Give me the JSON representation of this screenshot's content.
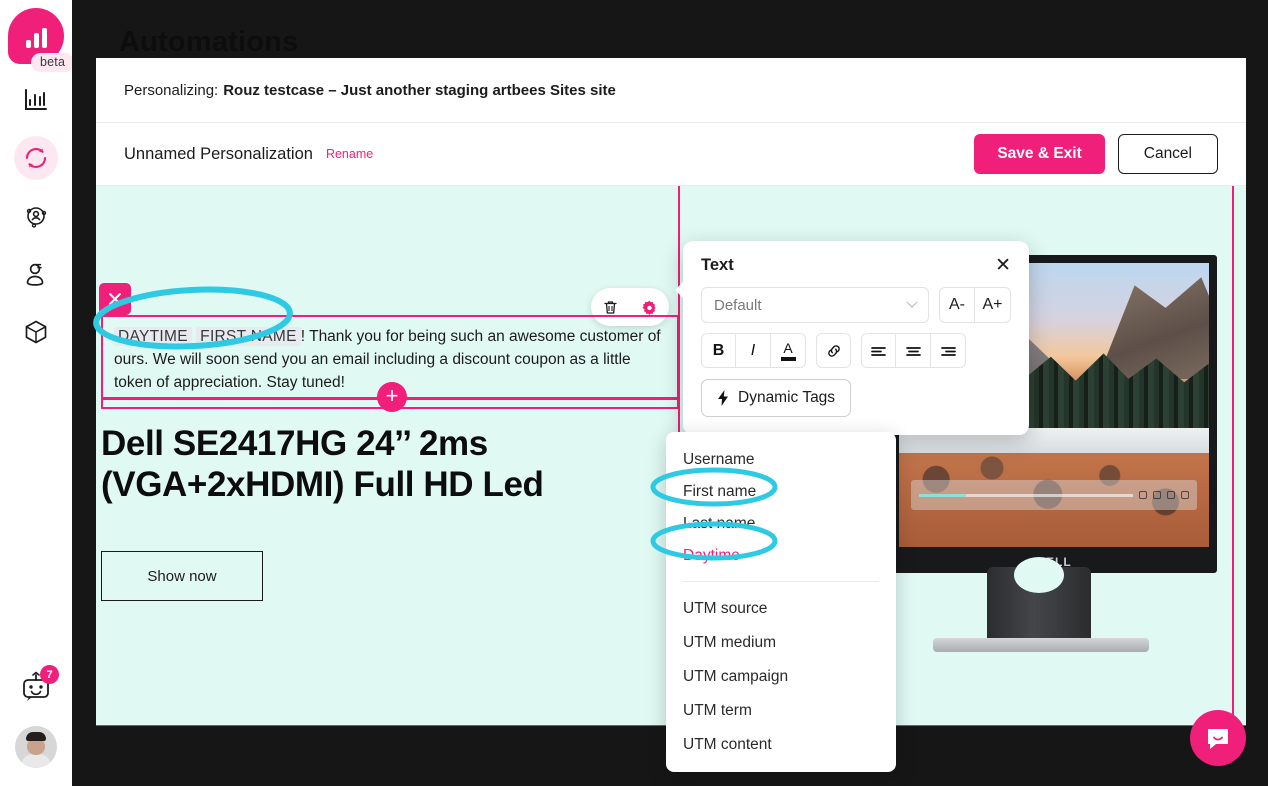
{
  "sidebar": {
    "logo_name": "artbees-logo",
    "beta_label": "beta",
    "items": [
      {
        "icon": "bar-chart-icon",
        "name": "analytics"
      },
      {
        "icon": "refresh-cycle-icon",
        "name": "automations"
      },
      {
        "icon": "audience-network-icon",
        "name": "audience"
      },
      {
        "icon": "visitor-icon",
        "name": "visitors"
      },
      {
        "icon": "package-cube-icon",
        "name": "products"
      }
    ],
    "bot_icon": "chat-bot-icon",
    "bot_badge": "7",
    "avatar_name": "user-avatar"
  },
  "page": {
    "title": "Automations"
  },
  "modal": {
    "header_prefix": "Personalizing:",
    "header_site": "Rouz testcase – Just another staging artbees Sites site",
    "personalization_name": "Unnamed Personalization",
    "rename_label": "Rename",
    "save_label": "Save & Exit",
    "cancel_label": "Cancel"
  },
  "canvas": {
    "text_block": {
      "tag1": "DAYTIME",
      "tag2": "FIRST NAME",
      "body": "! Thank you for being such an awesome customer of ours. We will soon send you an email including a discount coupon as a little token of appreciation. Stay tuned!"
    },
    "block_tools": {
      "delete_icon": "trash-icon",
      "settings_icon": "gear-icon"
    },
    "add_button_label": "+",
    "product_title": "Dell SE2417HG 24’’ 2ms (VGA+2xHDMI) Full HD Led",
    "show_now_label": "Show now",
    "monitor_brand": "DELL"
  },
  "text_popover": {
    "title": "Text",
    "close_icon": "close-icon",
    "font_select_value": "Default",
    "decrease_size_label": "A-",
    "increase_size_label": "A+",
    "bold_label": "B",
    "italic_label": "I",
    "color_label": "A",
    "link_icon": "link-icon",
    "align_left_icon": "align-left-icon",
    "align_center_icon": "align-center-icon",
    "align_right_icon": "align-right-icon",
    "dynamic_tags_label": "Dynamic Tags",
    "dynamic_tags_icon": "lightning-bolt-icon"
  },
  "dynamic_dropdown": {
    "group1": [
      {
        "label": "Username",
        "selected": false
      },
      {
        "label": "First name",
        "selected": false
      },
      {
        "label": "Last name",
        "selected": false
      },
      {
        "label": "Daytime",
        "selected": true
      }
    ],
    "group2": [
      {
        "label": "UTM source"
      },
      {
        "label": "UTM medium"
      },
      {
        "label": "UTM campaign"
      },
      {
        "label": "UTM term"
      },
      {
        "label": "UTM content"
      }
    ]
  },
  "annotations": {
    "ellipse_color": "#2ec9e3",
    "items": [
      "text-block-tags-highlight",
      "first-name-option-highlight",
      "daytime-option-highlight"
    ]
  },
  "colors": {
    "accent": "#f01f7a",
    "canvas_bg": "#e0f9f3",
    "overlay": "#161616",
    "annotation": "#2ec9e3"
  },
  "intercom": {
    "icon": "chat-bubble-icon"
  }
}
